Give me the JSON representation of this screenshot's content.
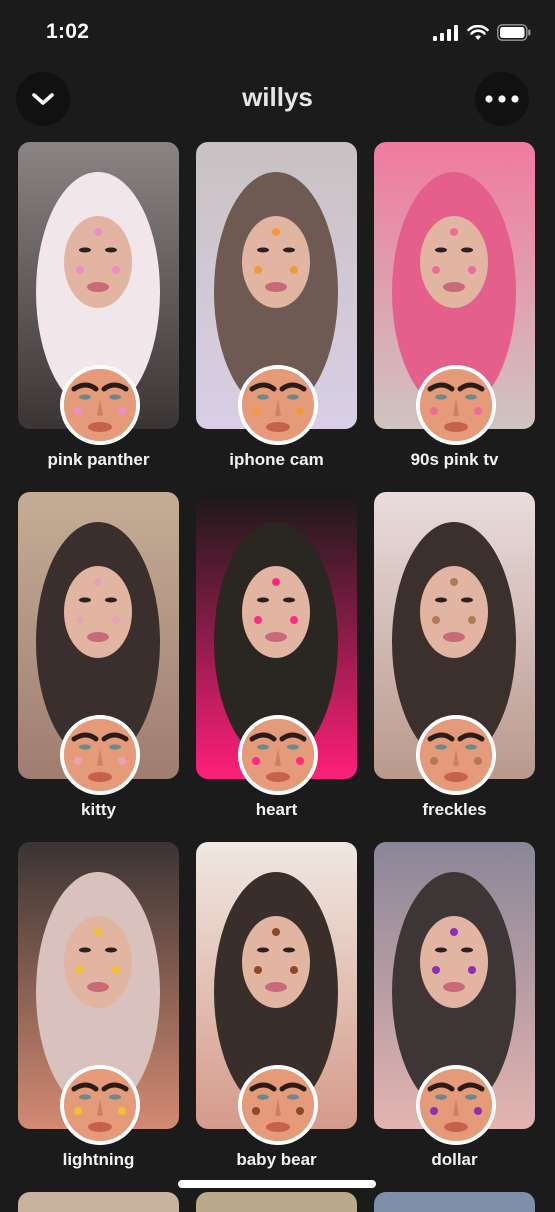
{
  "status_bar": {
    "time": "1:02",
    "icons": [
      "signal-icon",
      "wifi-icon",
      "battery-icon"
    ]
  },
  "header": {
    "title": "willys",
    "left_icon": "chevron-down-icon",
    "right_icon": "more-horizontal-icon"
  },
  "lenses": [
    {
      "name": "pink panther",
      "thumb_colors": [
        "#8a8484",
        "#f1e6ea",
        "#3a3434"
      ],
      "accent": "#f08cc8"
    },
    {
      "name": "iphone cam",
      "thumb_colors": [
        "#c9c2c2",
        "#6e5a52",
        "#d8cfe6"
      ],
      "accent": "#f29a3a"
    },
    {
      "name": "90s pink tv",
      "thumb_colors": [
        "#f07aa0",
        "#e45f8c",
        "#cfc4c0"
      ],
      "accent": "#ee6d98"
    },
    {
      "name": "kitty",
      "thumb_colors": [
        "#c4ad96",
        "#3b2f2e",
        "#9f7d71"
      ],
      "accent": "#e3a5b4"
    },
    {
      "name": "heart",
      "thumb_colors": [
        "#191918",
        "#2a2622",
        "#ff1f7a"
      ],
      "accent": "#ff2b82"
    },
    {
      "name": "freckles",
      "thumb_colors": [
        "#e9dcdd",
        "#3c302d",
        "#b9998c"
      ],
      "accent": "#b07a5a"
    },
    {
      "name": "lightning",
      "thumb_colors": [
        "#3a3433",
        "#d9c2be",
        "#d48a72"
      ],
      "accent": "#f2c12f"
    },
    {
      "name": "baby bear",
      "thumb_colors": [
        "#efe8e2",
        "#3a2e2a",
        "#d59a8a"
      ],
      "accent": "#8a4a2a"
    },
    {
      "name": "dollar",
      "thumb_colors": [
        "#8a8698",
        "#3e3636",
        "#e3b4b0"
      ],
      "accent": "#8b2fb5"
    }
  ]
}
